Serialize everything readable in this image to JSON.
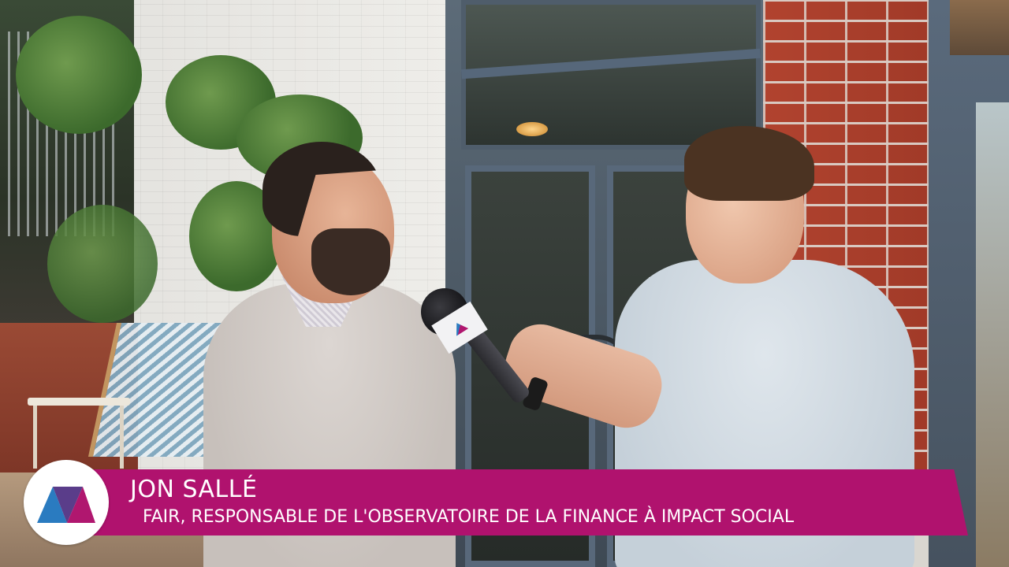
{
  "lower_third": {
    "name": "JON SALLÉ",
    "title": "FAIR, RESPONSABLE DE L'OBSERVATOIRE DE LA FINANCE À IMPACT SOCIAL",
    "bar_color": "#b0126e",
    "text_color": "#ffffff"
  },
  "logo": {
    "icon": "channel-logo-icon",
    "colors": [
      "#2a7bc0",
      "#b0176f",
      "#5a3d8a"
    ]
  },
  "scene": {
    "icons": [
      "microphone-icon"
    ]
  }
}
